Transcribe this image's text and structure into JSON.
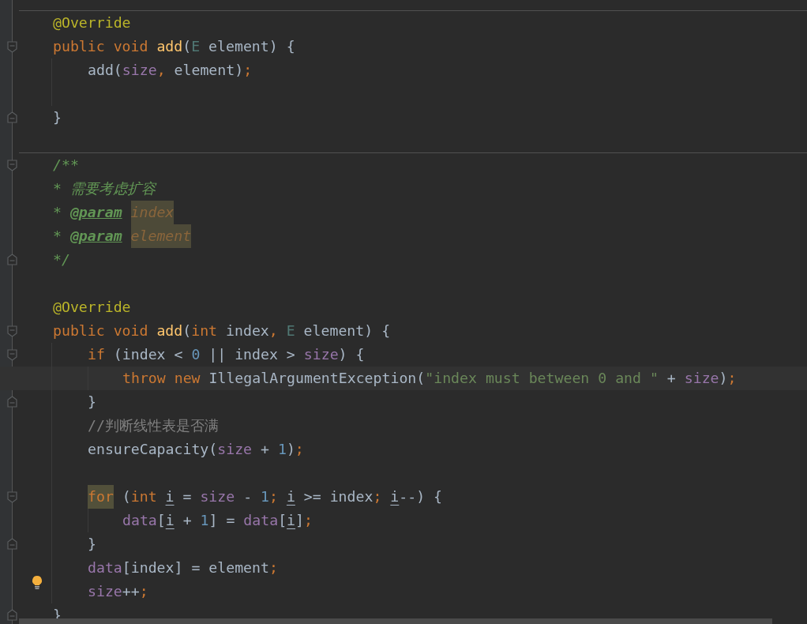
{
  "editor": {
    "lines": [
      {
        "separator": true,
        "current": false,
        "tokens": [
          {
            "kind": "annotation",
            "text": "@Override"
          }
        ]
      },
      {
        "separator": false,
        "current": false,
        "kind": "opener",
        "tokens": [
          {
            "kind": "keyword",
            "text": "public void "
          },
          {
            "kind": "function",
            "text": "add"
          },
          {
            "kind": "plain",
            "text": "("
          },
          {
            "kind": "typeparam",
            "text": "E"
          },
          {
            "kind": "plain",
            "text": " element) {"
          }
        ]
      },
      {
        "separator": false,
        "current": false,
        "tokens": [
          {
            "kind": "plain",
            "text": "    add("
          },
          {
            "kind": "field",
            "text": "size"
          },
          {
            "kind": "keyword",
            "text": ", "
          },
          {
            "kind": "plain",
            "text": "element)"
          },
          {
            "kind": "keyword",
            "text": ";"
          }
        ]
      },
      {
        "separator": false,
        "current": false
      },
      {
        "separator": false,
        "current": false,
        "kind": "closer",
        "tokens": [
          {
            "kind": "plain",
            "text": "}"
          }
        ]
      },
      {
        "separator": false,
        "current": false
      },
      {
        "separator": true,
        "current": false,
        "kind": "opener",
        "tokens": [
          {
            "kind": "doc",
            "text": "/**"
          }
        ]
      },
      {
        "separator": false,
        "current": false,
        "tokens": [
          {
            "kind": "doc",
            "text": " * 需要考虑扩容"
          }
        ]
      },
      {
        "separator": false,
        "current": false,
        "tokens": [
          {
            "kind": "doc",
            "text": " * "
          },
          {
            "kind": "doctag",
            "text": "@param"
          },
          {
            "kind": "docparam",
            "text": "index"
          }
        ]
      },
      {
        "separator": false,
        "current": false,
        "tokens": [
          {
            "kind": "doc",
            "text": " * "
          },
          {
            "kind": "doctag",
            "text": "@param"
          },
          {
            "kind": "docparam",
            "text": "element"
          }
        ]
      },
      {
        "separator": false,
        "current": false,
        "kind": "closer",
        "tokens": [
          {
            "kind": "doc",
            "text": " */"
          }
        ]
      },
      {
        "separator": false,
        "current": false
      },
      {
        "separator": false,
        "current": false,
        "tokens": [
          {
            "kind": "annotation",
            "text": "@Override"
          }
        ]
      },
      {
        "separator": false,
        "current": false,
        "kind": "opener",
        "tokens": [
          {
            "kind": "keyword",
            "text": "public void "
          },
          {
            "kind": "function",
            "text": "add"
          },
          {
            "kind": "plain",
            "text": "("
          },
          {
            "kind": "keyword",
            "text": "int "
          },
          {
            "kind": "plain",
            "text": "index"
          },
          {
            "kind": "keyword",
            "text": ", "
          },
          {
            "kind": "typeparam",
            "text": "E"
          },
          {
            "kind": "plain",
            "text": " element) {"
          }
        ]
      },
      {
        "separator": false,
        "current": false,
        "kind": "opener",
        "tokens": [
          {
            "kind": "keyword",
            "text": "    if "
          },
          {
            "kind": "plain",
            "text": "(index < "
          },
          {
            "kind": "number",
            "text": "0"
          },
          {
            "kind": "plain",
            "text": " || index > "
          },
          {
            "kind": "field",
            "text": "size"
          },
          {
            "kind": "plain",
            "text": ") {"
          }
        ]
      },
      {
        "separator": false,
        "current": true,
        "tokens": [
          {
            "kind": "keyword",
            "text": "        throw new "
          },
          {
            "kind": "plain",
            "text": "IllegalArgumentException("
          },
          {
            "kind": "string",
            "text": "\"index must between 0 and \""
          },
          {
            "kind": "plain",
            "text": " + "
          },
          {
            "kind": "field",
            "text": "size"
          },
          {
            "kind": "plain",
            "text": ")"
          },
          {
            "kind": "keyword",
            "text": ";"
          }
        ]
      },
      {
        "separator": false,
        "current": false,
        "kind": "closer",
        "tokens": [
          {
            "kind": "plain",
            "text": "    }"
          }
        ]
      },
      {
        "separator": false,
        "current": false,
        "tokens": [
          {
            "kind": "comment",
            "text": "    //判断线性表是否满"
          }
        ]
      },
      {
        "separator": false,
        "current": false,
        "tokens": [
          {
            "kind": "plain",
            "text": "    ensureCapacity("
          },
          {
            "kind": "field",
            "text": "size"
          },
          {
            "kind": "plain",
            "text": " + "
          },
          {
            "kind": "number",
            "text": "1"
          },
          {
            "kind": "plain",
            "text": ")"
          },
          {
            "kind": "keyword",
            "text": ";"
          }
        ]
      },
      {
        "separator": false,
        "current": false
      },
      {
        "separator": false,
        "current": false,
        "kind": "opener",
        "tokens": [
          {
            "kind": "marked",
            "text": "    for"
          },
          {
            "kind": "plain",
            "text": " ("
          },
          {
            "kind": "keyword",
            "text": "int "
          },
          {
            "kind": "reassigned",
            "text": "i"
          },
          {
            "kind": "plain",
            "text": " = "
          },
          {
            "kind": "field",
            "text": "size"
          },
          {
            "kind": "plain",
            "text": " - "
          },
          {
            "kind": "number",
            "text": "1"
          },
          {
            "kind": "keyword",
            "text": "; "
          },
          {
            "kind": "reassigned",
            "text": "i"
          },
          {
            "kind": "plain",
            "text": " >= index"
          },
          {
            "kind": "keyword",
            "text": "; "
          },
          {
            "kind": "reassigned",
            "text": "i"
          },
          {
            "kind": "plain",
            "text": "--) {"
          }
        ]
      },
      {
        "separator": false,
        "current": false,
        "tokens": [
          {
            "kind": "field",
            "text": "        data"
          },
          {
            "kind": "plain",
            "text": "["
          },
          {
            "kind": "reassigned",
            "text": "i"
          },
          {
            "kind": "plain",
            "text": " + "
          },
          {
            "kind": "number",
            "text": "1"
          },
          {
            "kind": "plain",
            "text": "] = "
          },
          {
            "kind": "field",
            "text": "data"
          },
          {
            "kind": "plain",
            "text": "["
          },
          {
            "kind": "reassigned",
            "text": "i"
          },
          {
            "kind": "plain",
            "text": "]"
          },
          {
            "kind": "keyword",
            "text": ";"
          }
        ]
      },
      {
        "separator": false,
        "current": false,
        "kind": "closer",
        "tokens": [
          {
            "kind": "plain",
            "text": "    }"
          }
        ]
      },
      {
        "separator": false,
        "current": false,
        "tokens": [
          {
            "kind": "field",
            "text": "    data"
          },
          {
            "kind": "plain",
            "text": "[index] = element"
          },
          {
            "kind": "keyword",
            "text": ";"
          }
        ]
      },
      {
        "separator": false,
        "current": false,
        "kind": "hint",
        "tokens": [
          {
            "kind": "field",
            "text": "    size"
          },
          {
            "kind": "plain",
            "text": "++"
          },
          {
            "kind": "keyword",
            "text": ";"
          }
        ]
      },
      {
        "separator": false,
        "current": false,
        "kind": "closer",
        "tokens": [
          {
            "kind": "plain",
            "text": "}"
          }
        ]
      }
    ]
  }
}
